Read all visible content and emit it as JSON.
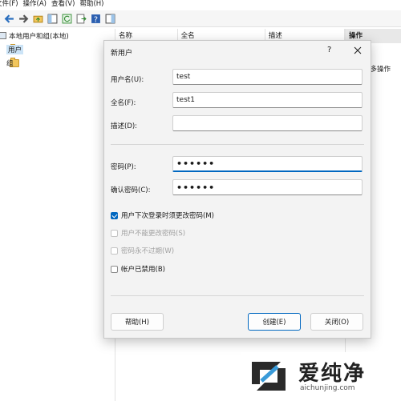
{
  "menu": [
    "文件(F)",
    "操作(A)",
    "查看(V)",
    "帮助(H)"
  ],
  "tree": {
    "root": "本地用户和组(本地)",
    "items": [
      "用户",
      "组"
    ]
  },
  "list_columns": [
    "名称",
    "全名",
    "描述"
  ],
  "actions": {
    "header": "操作",
    "item": "更多操作"
  },
  "dialog": {
    "title": "新用户",
    "help": "?",
    "fields": {
      "username": {
        "label": "用户名(U):",
        "value": "test"
      },
      "fullname": {
        "label": "全名(F):",
        "value": "test1"
      },
      "description": {
        "label": "描述(D):",
        "value": ""
      },
      "password": {
        "label": "密码(P):",
        "value": "••••••"
      },
      "confirm": {
        "label": "确认密码(C):",
        "value": "••••••"
      }
    },
    "checkboxes": [
      {
        "label": "用户下次登录时须更改密码(M)",
        "checked": true,
        "enabled": true
      },
      {
        "label": "用户不能更改密码(S)",
        "checked": false,
        "enabled": false
      },
      {
        "label": "密码永不过期(W)",
        "checked": false,
        "enabled": false
      },
      {
        "label": "帐户已禁用(B)",
        "checked": false,
        "enabled": true
      }
    ],
    "buttons": {
      "help": "帮助(H)",
      "create": "创建(E)",
      "close": "关闭(O)"
    }
  },
  "watermark": {
    "brand": "爱纯净",
    "url": "aichunjing.com"
  },
  "colors": {
    "accent": "#0067c0",
    "folder": "#f2c65c",
    "selection": "#cce4f7"
  }
}
